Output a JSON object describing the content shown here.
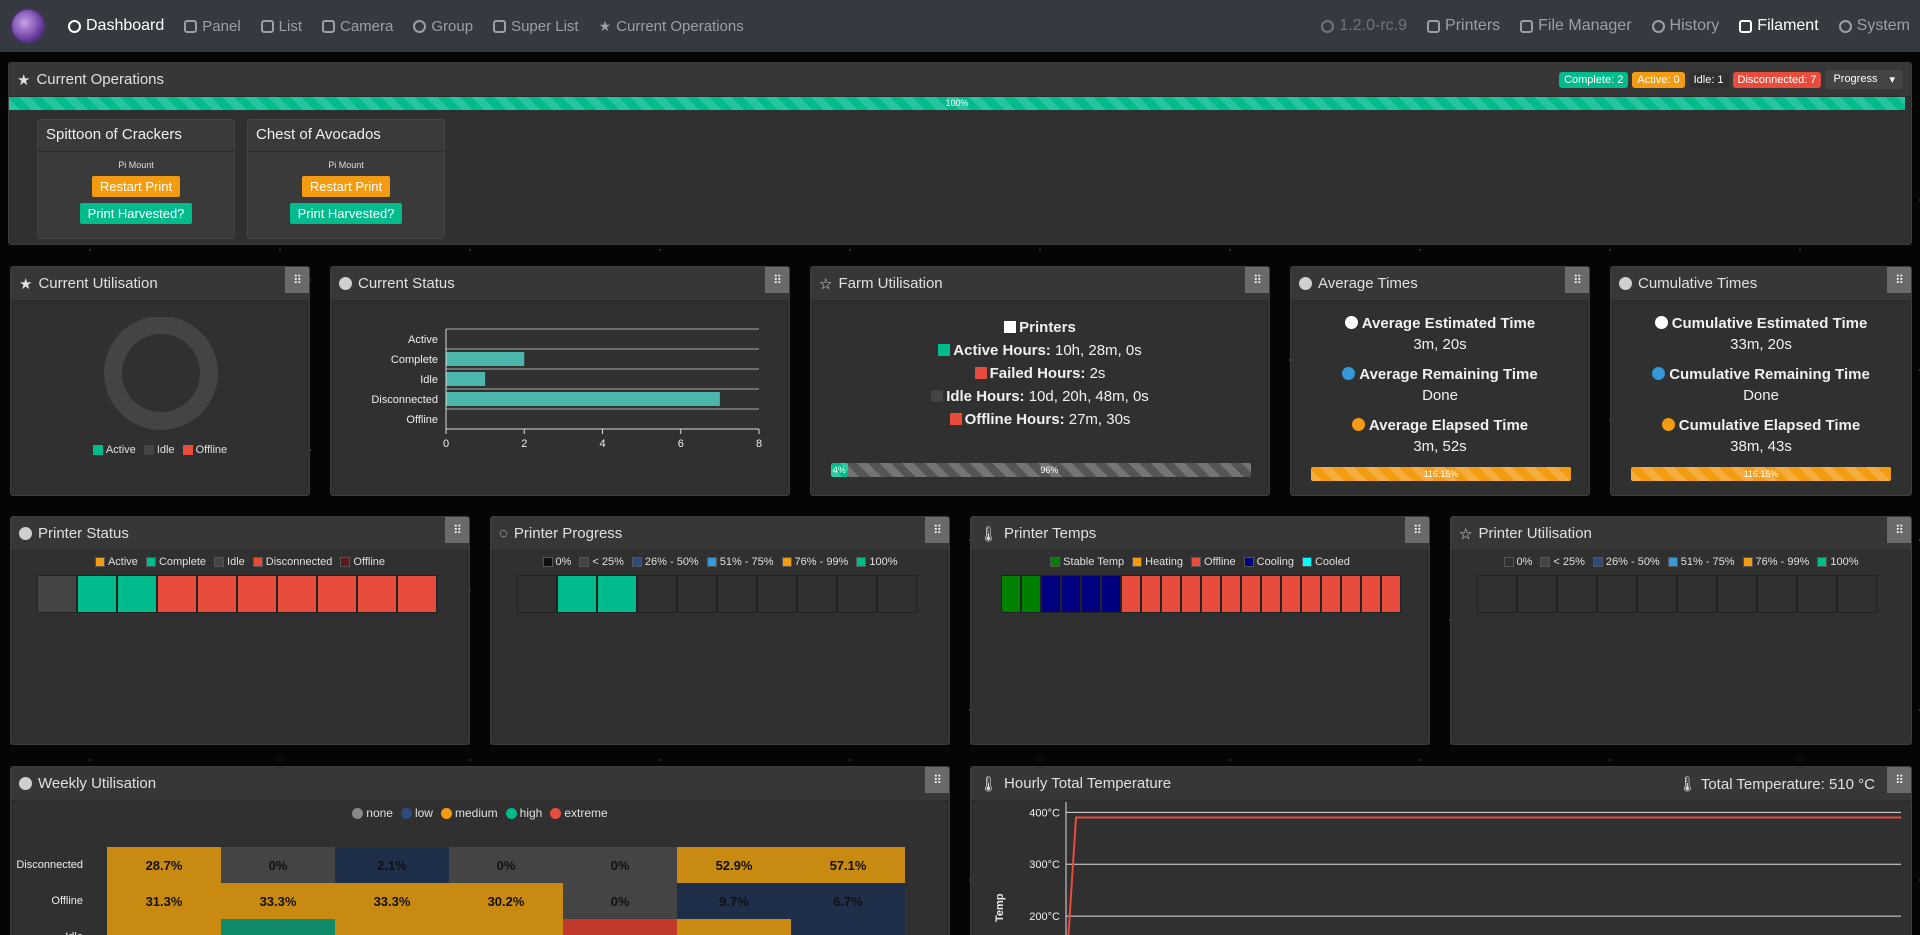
{
  "nav": {
    "left": [
      {
        "label": "Dashboard",
        "icon": "dashboard-icon"
      },
      {
        "label": "Panel",
        "icon": "panel-icon"
      },
      {
        "label": "List",
        "icon": "list-icon"
      },
      {
        "label": "Camera",
        "icon": "camera-icon"
      },
      {
        "label": "Group",
        "icon": "group-icon"
      },
      {
        "label": "Super List",
        "icon": "super-list-icon"
      },
      {
        "label": "Current Operations",
        "icon": "star-icon"
      }
    ],
    "version": "1.2.0-rc.9",
    "right": [
      {
        "label": "Printers",
        "icon": "printer-icon"
      },
      {
        "label": "File Manager",
        "icon": "folder-icon"
      },
      {
        "label": "History",
        "icon": "history-icon"
      },
      {
        "label": "Filament",
        "icon": "filament-icon"
      },
      {
        "label": "System",
        "icon": "gears-icon"
      }
    ]
  },
  "current_operations": {
    "title": "Current Operations",
    "badges": {
      "complete": "Complete: 2",
      "active": "Active: 0",
      "idle": "Idle: 1",
      "disconnected": "Disconnected: 7"
    },
    "sort_label": "Progress",
    "progress_label": "100%",
    "progress": 1.0,
    "ops": [
      {
        "title": "Spittoon of Crackers",
        "sub": "Pi Mount",
        "restart": "Restart Print",
        "harvest": "Print Harvested?"
      },
      {
        "title": "Chest of Avocados",
        "sub": "Pi Mount",
        "restart": "Restart Print",
        "harvest": "Print Harvested?"
      }
    ]
  },
  "current_utilisation": {
    "title": "Current Utilisation",
    "legend": [
      "Active",
      "Idle",
      "Offline"
    ]
  },
  "current_status": {
    "title": "Current Status"
  },
  "farm_utilisation": {
    "title": "Farm Utilisation",
    "printers_label": "Printers",
    "active_label": "Active Hours:",
    "active_value": "10h, 28m, 0s",
    "failed_label": "Failed Hours:",
    "failed_value": "2s",
    "idle_label": "Idle Hours:",
    "idle_value": "10d, 20h, 48m, 0s",
    "offline_label": "Offline Hours:",
    "offline_value": "27m, 30s",
    "active_pct_label": "4%",
    "idle_pct_label": "96%",
    "active_pct": 4,
    "idle_pct": 96
  },
  "average_times": {
    "title": "Average Times",
    "est_label": "Average Estimated Time",
    "est_value": "3m, 20s",
    "rem_label": "Average Remaining Time",
    "rem_value": "Done",
    "ela_label": "Average Elapsed Time",
    "ela_value": "3m, 52s",
    "bar_label": "116.15%"
  },
  "cumulative_times": {
    "title": "Cumulative Times",
    "est_label": "Cumulative Estimated Time",
    "est_value": "33m, 20s",
    "rem_label": "Cumulative Remaining Time",
    "rem_value": "Done",
    "ela_label": "Cumulative Elapsed Time",
    "ela_value": "38m, 43s",
    "bar_label": "116.15%"
  },
  "printer_status": {
    "title": "Printer Status",
    "legend": [
      {
        "label": "Active",
        "color": "#f39c12"
      },
      {
        "label": "Complete",
        "color": "#00bc8c"
      },
      {
        "label": "Idle",
        "color": "#444444"
      },
      {
        "label": "Disconnected",
        "color": "#e74c3c"
      },
      {
        "label": "Offline",
        "color": "#5a1a1a"
      }
    ],
    "tiles": [
      "#444444",
      "#00bc8c",
      "#00bc8c",
      "#e74c3c",
      "#e74c3c",
      "#e74c3c",
      "#e74c3c",
      "#e74c3c",
      "#e74c3c",
      "#e74c3c"
    ]
  },
  "printer_progress": {
    "title": "Printer Progress",
    "legend": [
      {
        "label": "0%",
        "color": "#111111"
      },
      {
        "label": "< 25%",
        "color": "#444444"
      },
      {
        "label": "26% - 50%",
        "color": "#2c4a7a"
      },
      {
        "label": "51% - 75%",
        "color": "#3498db"
      },
      {
        "label": "76% - 99%",
        "color": "#f39c12"
      },
      {
        "label": "100%",
        "color": "#00bc8c"
      }
    ],
    "tiles": [
      "#303030",
      "#00bc8c",
      "#00bc8c",
      "#303030",
      "#303030",
      "#303030",
      "#303030",
      "#303030",
      "#303030",
      "#303030"
    ]
  },
  "printer_temps": {
    "title": "Printer Temps",
    "legend": [
      {
        "label": "Stable Temp",
        "color": "#008000"
      },
      {
        "label": "Heating",
        "color": "#f39c12"
      },
      {
        "label": "Offline",
        "color": "#e74c3c"
      },
      {
        "label": "Cooling",
        "color": "#000080"
      },
      {
        "label": "Cooled",
        "color": "#00ffff"
      }
    ],
    "tiles": [
      "#008000",
      "#008000",
      "#000080",
      "#000080",
      "#000080",
      "#000080",
      "#e74c3c",
      "#e74c3c",
      "#e74c3c",
      "#e74c3c",
      "#e74c3c",
      "#e74c3c",
      "#e74c3c",
      "#e74c3c",
      "#e74c3c",
      "#e74c3c",
      "#e74c3c",
      "#e74c3c",
      "#e74c3c",
      "#e74c3c"
    ]
  },
  "printer_utilisation": {
    "title": "Printer Utilisation",
    "legend": [
      {
        "label": "0%",
        "color": "#303030"
      },
      {
        "label": "< 25%",
        "color": "#444444"
      },
      {
        "label": "26% - 50%",
        "color": "#2c4a7a"
      },
      {
        "label": "51% - 75%",
        "color": "#3498db"
      },
      {
        "label": "76% - 99%",
        "color": "#f39c12"
      },
      {
        "label": "100%",
        "color": "#00bc8c"
      }
    ],
    "tiles": [
      "#303030",
      "#303030",
      "#303030",
      "#303030",
      "#303030",
      "#303030",
      "#303030",
      "#303030",
      "#303030",
      "#303030"
    ]
  },
  "weekly_utilisation": {
    "title": "Weekly Utilisation",
    "legend": [
      {
        "label": "none",
        "color": "#888888"
      },
      {
        "label": "low",
        "color": "#2c4a7a"
      },
      {
        "label": "medium",
        "color": "#f39c12"
      },
      {
        "label": "high",
        "color": "#00bc8c"
      },
      {
        "label": "extreme",
        "color": "#e74c3c"
      }
    ]
  },
  "hourly_temperature": {
    "title": "Hourly Total Temperature",
    "total_label": "Total Temperature: 510 °C"
  },
  "chart_data": [
    {
      "type": "pie",
      "title": "Current Utilisation",
      "categories": [
        "Active",
        "Idle",
        "Offline"
      ],
      "values": [
        0,
        0,
        0
      ],
      "colors": [
        "#00bc8c",
        "#444444",
        "#e74c3c"
      ]
    },
    {
      "type": "bar",
      "title": "Current Status",
      "orientation": "horizontal",
      "categories": [
        "Active",
        "Complete",
        "Idle",
        "Disconnected",
        "Offline"
      ],
      "values": [
        0,
        2,
        1,
        7,
        0
      ],
      "xlim": [
        0,
        8
      ],
      "xticks": [
        "0",
        "2",
        "4",
        "6",
        "8"
      ],
      "color": "#4db6ac"
    },
    {
      "type": "heatmap",
      "title": "Weekly Utilisation",
      "rows": [
        "Disconnected",
        "Offline",
        "Idle"
      ],
      "cells": [
        [
          {
            "v": "28.7%",
            "c": "#c98a12"
          },
          {
            "v": "0%",
            "c": "#444444"
          },
          {
            "v": "2.1%",
            "c": "#1f2f4a"
          },
          {
            "v": "0%",
            "c": "#444444"
          },
          {
            "v": "0%",
            "c": "#444444"
          },
          {
            "v": "52.9%",
            "c": "#c98a12"
          },
          {
            "v": "57.1%",
            "c": "#c98a12"
          }
        ],
        [
          {
            "v": "31.3%",
            "c": "#c98a12"
          },
          {
            "v": "33.3%",
            "c": "#c98a12"
          },
          {
            "v": "33.3%",
            "c": "#c98a12"
          },
          {
            "v": "30.2%",
            "c": "#c98a12"
          },
          {
            "v": "0%",
            "c": "#444444"
          },
          {
            "v": "9.7%",
            "c": "#1f2f4a"
          },
          {
            "v": "6.7%",
            "c": "#1f2f4a"
          }
        ],
        [
          {
            "v": "",
            "c": "#c98a12"
          },
          {
            "v": "",
            "c": "#0f8a6a"
          },
          {
            "v": "",
            "c": "#c98a12"
          },
          {
            "v": "",
            "c": "#c98a12"
          },
          {
            "v": "",
            "c": "#c0392b"
          },
          {
            "v": "",
            "c": "#c98a12"
          },
          {
            "v": "",
            "c": "#1f2f4a"
          }
        ]
      ]
    },
    {
      "type": "line",
      "title": "Hourly Total Temperature",
      "ylabel": "Temp",
      "yticks": [
        "400°C",
        "300°C",
        "200°C"
      ],
      "ylim": [
        150,
        420
      ],
      "series": [
        {
          "values": [
            150,
            390,
            390,
            390,
            390,
            390,
            390,
            390,
            390,
            390
          ],
          "color": "#e74c3c"
        }
      ]
    }
  ]
}
